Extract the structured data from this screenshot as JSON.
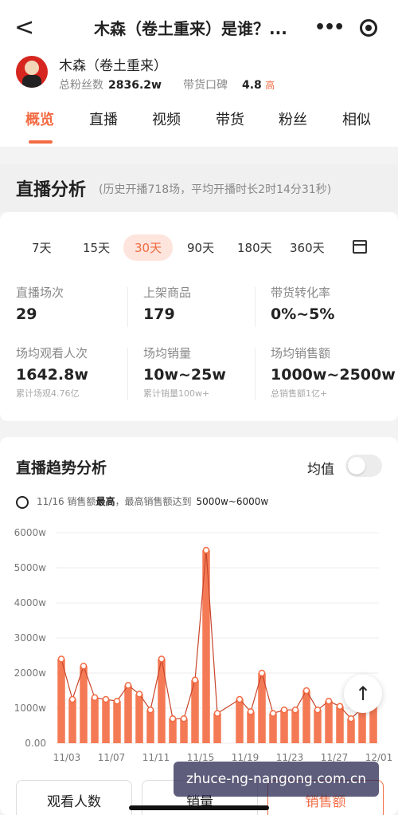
{
  "header": {
    "back_label": "<",
    "title": "木森（卷土重来）是谁？...",
    "more_label": "•••"
  },
  "profile": {
    "name": "木森（卷土重来）",
    "fans_label": "总粉丝数",
    "fans_value": "2836.2w",
    "rep_label": "带货口碑",
    "rep_value": "4.8",
    "rep_level": "高"
  },
  "tabs": [
    "概览",
    "直播",
    "视频",
    "带货",
    "粉丝",
    "相似"
  ],
  "section": {
    "title": "直播分析",
    "subtitle": "(历史开播718场，平均开播时长2时14分31秒)"
  },
  "periods": [
    "7天",
    "15天",
    "30天",
    "90天",
    "180天",
    "360天"
  ],
  "active_period": "30天",
  "stats": [
    {
      "label": "直播场次",
      "value": "29",
      "sub": ""
    },
    {
      "label": "上架商品",
      "value": "179",
      "sub": ""
    },
    {
      "label": "带货转化率",
      "value": "0%~5%",
      "sub": ""
    },
    {
      "label": "场均观看人次",
      "value": "1642.8w",
      "sub": "累计场观4.76亿"
    },
    {
      "label": "场均销量",
      "value": "10w~25w",
      "sub": "累计销量100w+"
    },
    {
      "label": "场均销售额",
      "value": "1000w~2500w",
      "sub": "总销售额1亿+"
    }
  ],
  "trend": {
    "title": "直播趋势分析",
    "toggle_label": "均值",
    "note_date": "11/16",
    "note_text1": "销售额",
    "note_bold": "最高",
    "note_text2": "，最高销售额达到",
    "note_range": "5000w~6000w"
  },
  "chart_data": {
    "type": "bar",
    "y_ticks": [
      "0.00",
      "1000w",
      "2000w",
      "3000w",
      "4000w",
      "5000w",
      "6000w"
    ],
    "x_ticks": [
      "11/03",
      "11/07",
      "11/11",
      "11/15",
      "11/19",
      "11/23",
      "11/27",
      "12/01"
    ],
    "ylim": [
      0,
      6000
    ],
    "unit": "w",
    "values": [
      2400,
      1250,
      2200,
      1300,
      1250,
      1200,
      1650,
      1400,
      950,
      2400,
      700,
      700,
      1800,
      5500,
      850,
      null,
      1250,
      900,
      2000,
      850,
      950,
      950,
      1500,
      950,
      1200,
      1050,
      700,
      1000,
      1050
    ]
  },
  "colors": {
    "accent": "#f36b43",
    "bar": "#f47a55"
  },
  "bottom_buttons": [
    "观看人数",
    "销量",
    "销售额"
  ],
  "watermark": "zhuce-ng-nangong.com.cn",
  "fab_icon": "arrow-up-icon"
}
